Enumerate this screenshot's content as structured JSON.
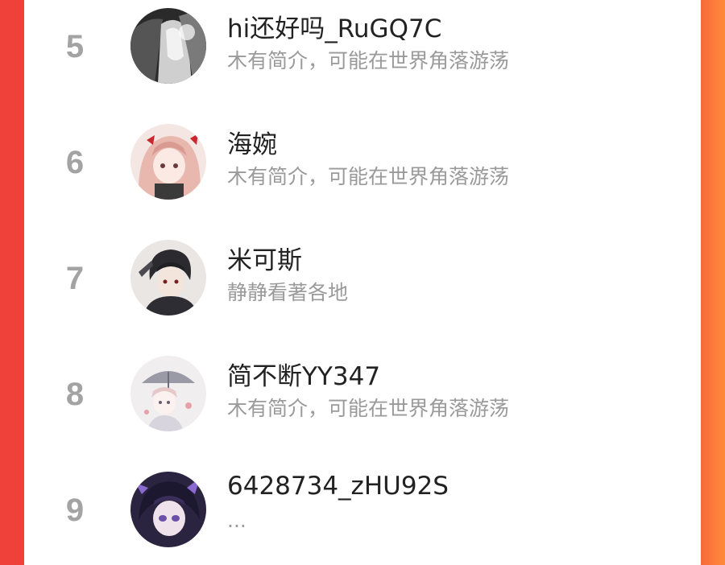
{
  "list": {
    "items": [
      {
        "rank": "5",
        "name": "hi还好吗_RuGQ7C",
        "bio": "木有简介，可能在世界角落游荡",
        "avatar_icon": "avatar-grayscale-portrait-icon"
      },
      {
        "rank": "6",
        "name": "海婉",
        "bio": "木有简介，可能在世界角落游荡",
        "avatar_icon": "avatar-anime-girl-pink-icon"
      },
      {
        "rank": "7",
        "name": "米可斯",
        "bio": "静静看著各地",
        "avatar_icon": "avatar-anime-boy-dark-icon"
      },
      {
        "rank": "8",
        "name": "简不断YY347",
        "bio": "木有简介，可能在世界角落游荡",
        "avatar_icon": "avatar-anime-umbrella-icon"
      },
      {
        "rank": "9",
        "name": "6428734_zHU92S",
        "bio": "...",
        "avatar_icon": "avatar-anime-purple-icon"
      }
    ]
  },
  "colors": {
    "left_edge": "#f0403a",
    "right_edge": "#ff8a3a",
    "rank": "#a3a3a3",
    "name": "#222222",
    "bio": "#9a9a9a"
  }
}
